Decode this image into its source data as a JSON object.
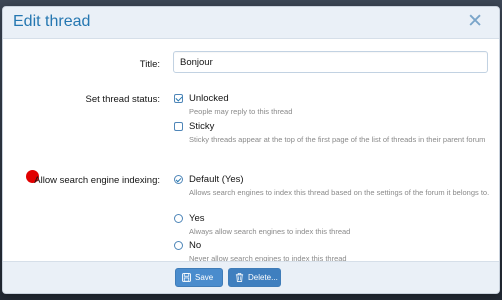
{
  "dialog": {
    "title": "Edit thread",
    "close_glyph": "✕"
  },
  "title_field": {
    "label": "Title:",
    "value": "Bonjour"
  },
  "status": {
    "label": "Set thread status:",
    "options": [
      {
        "label": "Unlocked",
        "hint": "People may reply to this thread",
        "checked": true
      },
      {
        "label": "Sticky",
        "hint": "Sticky threads appear at the top of the first page of the list of threads in their parent forum",
        "checked": false
      }
    ]
  },
  "search_indexing": {
    "label": "Allow search engine indexing:",
    "options": [
      {
        "label": "Default (Yes)",
        "hint": "Allows search engines to index this thread based on the settings of the forum it belongs to.",
        "selected": true
      },
      {
        "label": "Yes",
        "hint": "Always allow search engines to index this thread",
        "selected": false
      },
      {
        "label": "No",
        "hint": "Never allow search engines to index this thread",
        "selected": false
      }
    ]
  },
  "footer": {
    "save_label": "Save",
    "delete_label": "Delete..."
  },
  "icons": {
    "save": "save-icon",
    "delete": "trash-icon",
    "close": "close-icon",
    "marker": "red-dot"
  },
  "colors": {
    "accent": "#2577b1",
    "button": "#4a8ccd",
    "header_bg": "#eaf0f7",
    "marker": "#e10000"
  }
}
